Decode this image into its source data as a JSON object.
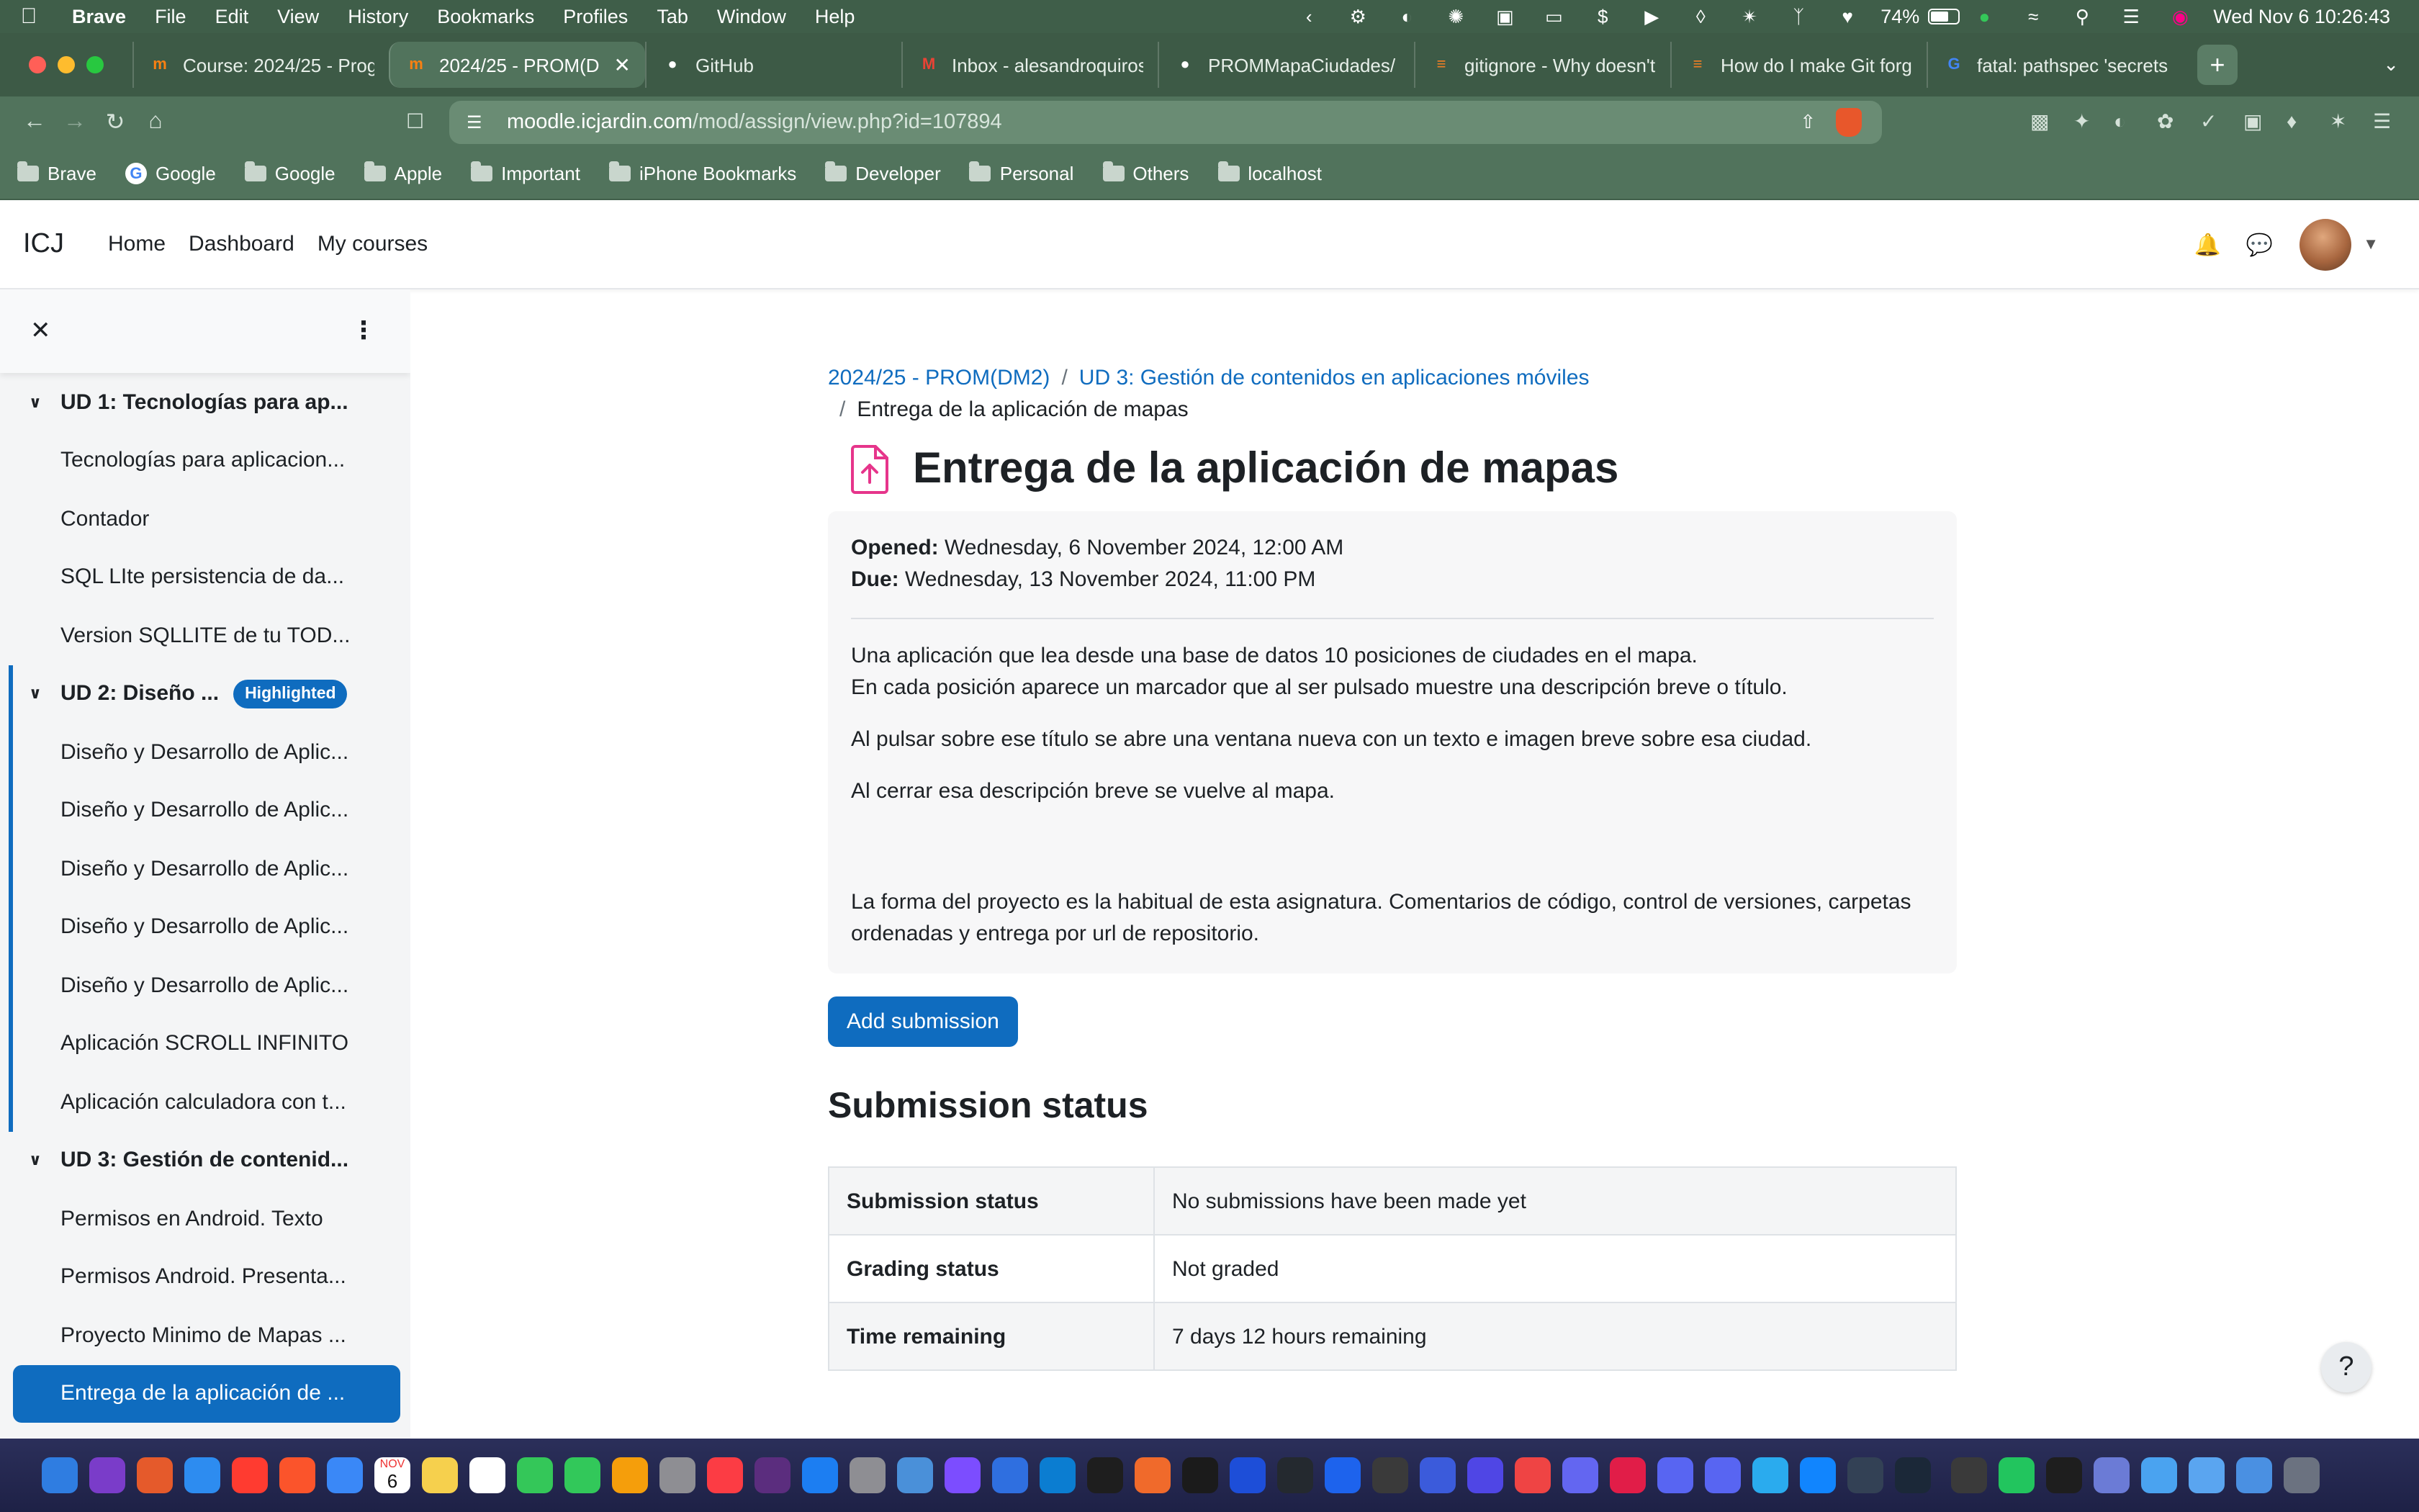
{
  "menubar": {
    "app": "Brave",
    "items": [
      "File",
      "Edit",
      "View",
      "History",
      "Bookmarks",
      "Profiles",
      "Tab",
      "Window",
      "Help"
    ],
    "battery_percent": "74%",
    "battery_level": 0.74,
    "datetime": "Wed Nov 6  10:26:43"
  },
  "tabs": [
    {
      "title": "Course: 2024/25 - Prog",
      "icon": "moodle-icon",
      "icon_color": "#f98012"
    },
    {
      "title": "2024/25 - PROM(D",
      "icon": "moodle-icon",
      "icon_color": "#f98012",
      "active": true
    },
    {
      "title": "GitHub",
      "icon": "github-icon",
      "icon_color": "#ffffff"
    },
    {
      "title": "Inbox - alesandroquiros",
      "icon": "gmail-icon",
      "icon_color": "#ea4335"
    },
    {
      "title": "PROMMapaCiudades/ a",
      "icon": "github-icon",
      "icon_color": "#ffffff"
    },
    {
      "title": "gitignore - Why doesn't",
      "icon": "stackoverflow-icon",
      "icon_color": "#f48024"
    },
    {
      "title": "How do I make Git forge",
      "icon": "stackoverflow-icon",
      "icon_color": "#f48024"
    },
    {
      "title": "fatal: pathspec 'secrets",
      "icon": "google-icon",
      "icon_color": "#4285f4"
    }
  ],
  "address": {
    "host": "moodle.icjardin.com",
    "path": "/mod/assign/view.php?id=107894"
  },
  "bookmarks": [
    {
      "label": "Brave",
      "icon": "folder-icon"
    },
    {
      "label": "Google",
      "icon": "google-icon"
    },
    {
      "label": "Google",
      "icon": "folder-icon"
    },
    {
      "label": "Apple",
      "icon": "folder-icon"
    },
    {
      "label": "Important",
      "icon": "folder-icon"
    },
    {
      "label": "iPhone Bookmarks",
      "icon": "folder-icon"
    },
    {
      "label": "Developer",
      "icon": "folder-icon"
    },
    {
      "label": "Personal",
      "icon": "folder-icon"
    },
    {
      "label": "Others",
      "icon": "folder-icon"
    },
    {
      "label": "localhost",
      "icon": "folder-icon"
    }
  ],
  "topnav": {
    "brand": "ICJ",
    "links": [
      "Home",
      "Dashboard",
      "My courses"
    ]
  },
  "drawer": {
    "sections": [
      {
        "title": "UD 1: Tecnologías para ap...",
        "items": [
          {
            "label": "Tecnologías para aplicacion..."
          },
          {
            "label": "Contador"
          },
          {
            "label": "SQL LIte persistencia de da..."
          },
          {
            "label": "Version SQLLITE de tu TOD..."
          }
        ]
      },
      {
        "title": "UD 2: Diseño ...",
        "badge": "Highlighted",
        "highlighted": true,
        "items": [
          {
            "label": "Diseño y Desarrollo de Aplic..."
          },
          {
            "label": "Diseño y Desarrollo de Aplic..."
          },
          {
            "label": "Diseño y Desarrollo de Aplic..."
          },
          {
            "label": "Diseño y Desarrollo de Aplic..."
          },
          {
            "label": "Diseño y Desarrollo de Aplic..."
          },
          {
            "label": "Aplicación SCROLL INFINITO"
          },
          {
            "label": "Aplicación calculadora con t..."
          }
        ]
      },
      {
        "title": "UD 3: Gestión de contenid...",
        "items": [
          {
            "label": "Permisos en Android. Texto"
          },
          {
            "label": "Permisos Android. Presenta..."
          },
          {
            "label": "Proyecto Minimo de Mapas ..."
          },
          {
            "label": "Entrega de la aplicación de ...",
            "active": true
          }
        ]
      }
    ]
  },
  "breadcrumb": {
    "course": "2024/25 - PROM(DM2)",
    "section": "UD 3: Gestión de contenidos en aplicaciones móviles",
    "current": "Entrega de la aplicación de mapas"
  },
  "assignment": {
    "title": "Entrega de la aplicación de mapas",
    "opened_label": "Opened:",
    "opened_value": "Wednesday, 6 November 2024, 12:00 AM",
    "due_label": "Due:",
    "due_value": "Wednesday, 13 November 2024, 11:00 PM",
    "desc1": "Una aplicación que lea desde una base de datos 10 posiciones de ciudades en el mapa.",
    "desc2": "En cada posición aparece un marcador que al ser pulsado muestre una descripción breve o título.",
    "desc3": "Al pulsar sobre ese título se abre una ventana nueva con un texto e imagen breve sobre esa ciudad.",
    "desc4": "Al cerrar esa descripción breve se vuelve al mapa.",
    "desc5": "La forma del proyecto es la habitual de esta asignatura. Comentarios de código, control de versiones, carpetas ordenadas y entrega por url de repositorio.",
    "add_submission": "Add submission"
  },
  "submission": {
    "heading": "Submission status",
    "rows": [
      {
        "key": "Submission status",
        "value": "No submissions have been made yet"
      },
      {
        "key": "Grading status",
        "value": "Not graded"
      },
      {
        "key": "Time remaining",
        "value": "7 days 12 hours remaining"
      }
    ]
  },
  "help_label": "?",
  "dock": {
    "calendar_month": "NOV",
    "calendar_day": "6",
    "colors": [
      "#2f7de1",
      "#7a3cc9",
      "#e55a2b",
      "#2d8cf0",
      "#ff3b30",
      "#fb542b",
      "#3a88f7",
      "#ffffff",
      "#f6d04d",
      "#ffffff",
      "#34c759",
      "#32c85a",
      "#f59e0b",
      "#8e8e93",
      "#fc3c44",
      "#5b2d7e",
      "#1c7ef2",
      "#8e8e93",
      "#4a90d9",
      "#7c4dff",
      "#2f6fe0",
      "#0b7dd1",
      "#1e1e1e",
      "#f06a2b",
      "#1b1b1b",
      "#1d4ed8",
      "#24292f",
      "#1d63ed",
      "#3a3a3a",
      "#3b5bdb",
      "#4f46e5",
      "#ef4444",
      "#6366f1",
      "#e11d48",
      "#5865f2",
      "#5865f2",
      "#2aabee",
      "#1185fe",
      "#334155",
      "#1b2838",
      "#3a3a3a",
      "#22c55e",
      "#1e1e1e",
      "#6b7bd6",
      "#4aa3f0",
      "#5aa5f0",
      "#4a90e2",
      "#6b7280"
    ]
  }
}
